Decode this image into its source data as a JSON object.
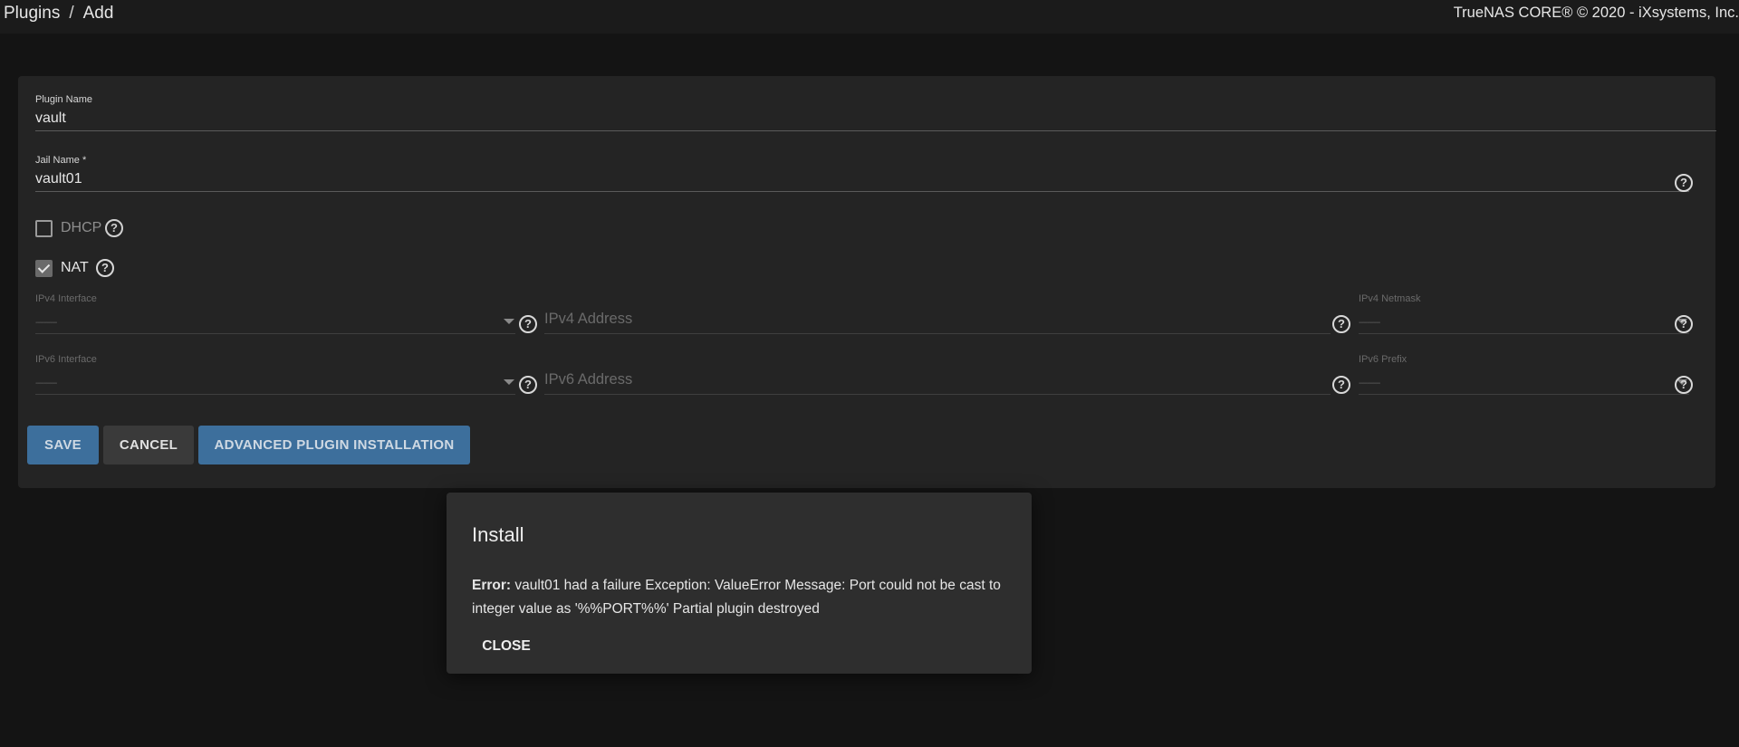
{
  "breadcrumb": {
    "parent": "Plugins",
    "separator": "/",
    "current": "Add"
  },
  "copyright": "TrueNAS CORE® © 2020 - iXsystems, Inc.",
  "form": {
    "plugin_name": {
      "label": "Plugin Name",
      "value": "vault"
    },
    "jail_name": {
      "label": "Jail Name *",
      "value": "vault01"
    },
    "dhcp": {
      "label": "DHCP",
      "checked": false
    },
    "nat": {
      "label": "NAT",
      "checked": true
    },
    "ipv4_interface": {
      "label": "IPv4 Interface",
      "value": "----------"
    },
    "ipv4_address": {
      "placeholder": "IPv4 Address"
    },
    "ipv4_netmask": {
      "label": "IPv4 Netmask",
      "value": "----------"
    },
    "ipv6_interface": {
      "label": "IPv6 Interface",
      "value": "----------"
    },
    "ipv6_address": {
      "placeholder": "IPv6 Address"
    },
    "ipv6_prefix": {
      "label": "IPv6 Prefix",
      "value": "----------"
    }
  },
  "buttons": {
    "save": "SAVE",
    "cancel": "CANCEL",
    "advanced": "ADVANCED PLUGIN INSTALLATION"
  },
  "dialog": {
    "title": "Install",
    "error_prefix": "Error:",
    "message": "vault01 had a failure Exception: ValueError Message: Port could not be cast to integer value as '%%PORT%%' Partial plugin destroyed",
    "close": "CLOSE"
  },
  "colors": {
    "primary": "#3d6f9c",
    "background": "#141414",
    "card": "#242424",
    "dialog": "#2e2e2e"
  },
  "icons": {
    "help": "help-circle-icon",
    "caret": "caret-down-icon",
    "check": "check-icon"
  }
}
